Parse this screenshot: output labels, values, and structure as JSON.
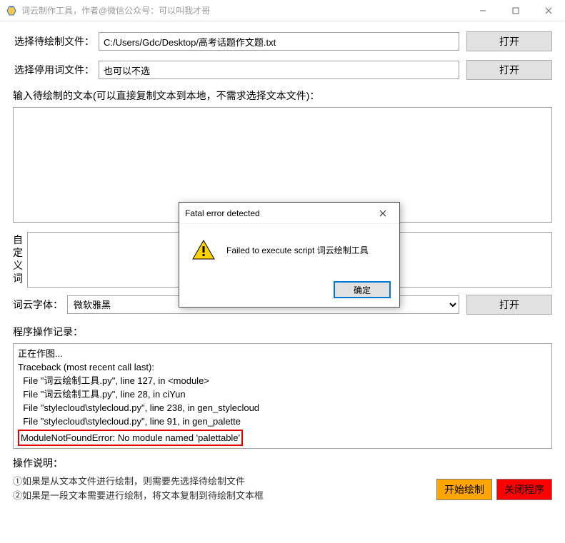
{
  "window": {
    "title": "词云制作工具，作者@微信公众号：可以叫我才哥"
  },
  "form": {
    "file_label": "选择待绘制文件：",
    "file_value": "C:/Users/Gdc/Desktop/高考话题作文题.txt",
    "stop_label": "选择停用词文件：",
    "stop_value": "也可以不选",
    "open_btn": "打开",
    "text_label": "输入待绘制的文本(可以直接复制文本到本地，不需求选择文本文件)：",
    "custom_label": "自定义词",
    "font_label": "词云字体：",
    "font_value": "微软雅黑"
  },
  "log": {
    "title": "程序操作记录：",
    "lines": [
      "正在作图...",
      "Traceback (most recent call last):",
      "  File \"词云绘制工具.py\", line 127, in <module>",
      "  File \"词云绘制工具.py\", line 28, in ciYun",
      "  File \"stylecloud\\stylecloud.py\", line 238, in gen_stylecloud",
      "  File \"stylecloud\\stylecloud.py\", line 91, in gen_palette"
    ],
    "error_line": "ModuleNotFoundError: No module named 'palettable'"
  },
  "instructions": {
    "title": "操作说明：",
    "line1": "①如果是从文本文件进行绘制，则需要先选择待绘制文件",
    "line2": "②如果是一段文本需要进行绘制，将文本复制到待绘制文本框"
  },
  "actions": {
    "start": "开始绘制",
    "close": "关闭程序"
  },
  "dialog": {
    "title": "Fatal error detected",
    "message": "Failed to execute script 词云绘制工具",
    "ok": "确定"
  }
}
